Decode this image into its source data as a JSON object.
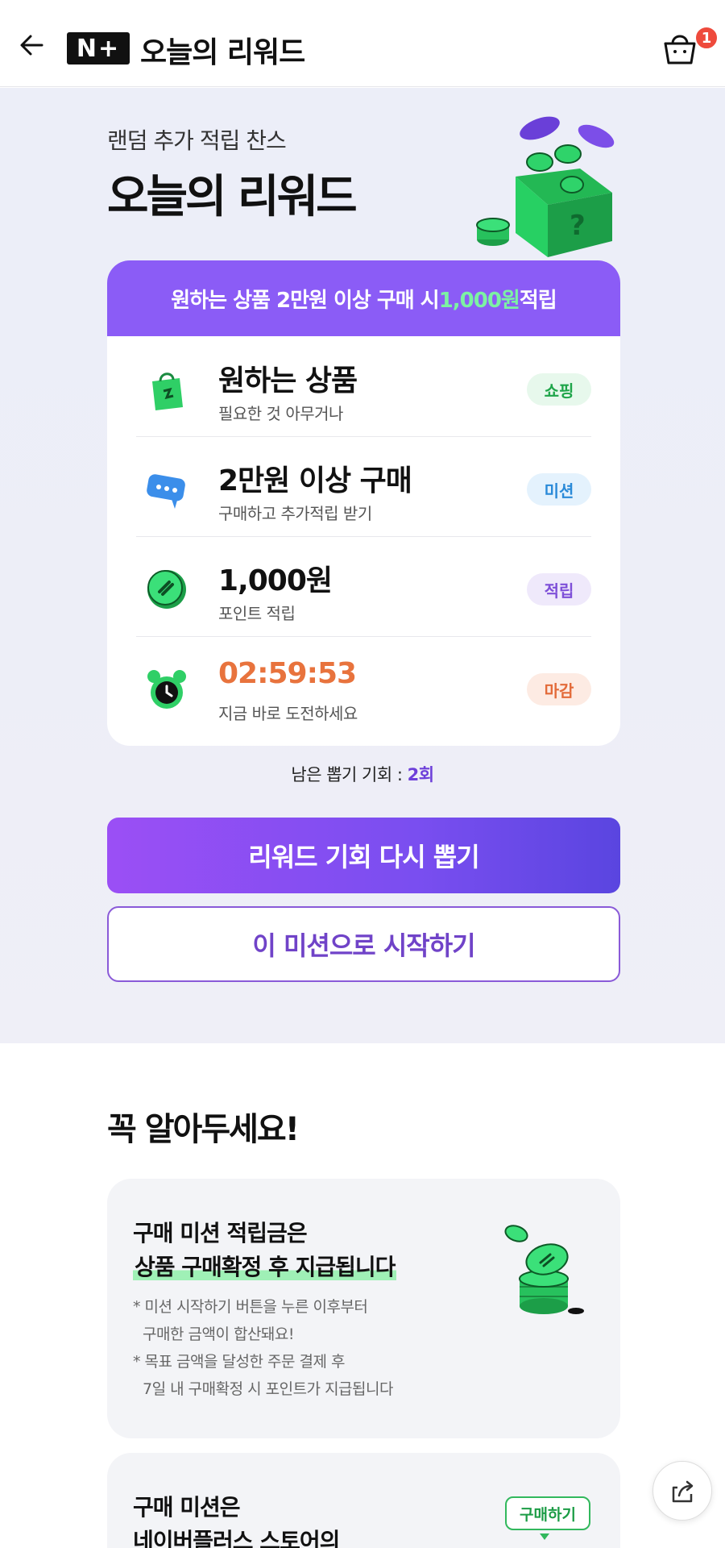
{
  "header": {
    "logo_text": "N+",
    "title": "오늘의 리워드",
    "cart_count": "1"
  },
  "hero": {
    "subtitle": "랜덤 추가 적립 찬스",
    "title": "오늘의 리워드"
  },
  "card": {
    "banner_prefix": "원하는 상품 2만원 이상 구매 시 ",
    "banner_highlight": "1,000원",
    "banner_suffix": " 적립",
    "rows": [
      {
        "main": "원하는 상품",
        "sub": "필요한 것 아무거나",
        "tag": "쇼핑",
        "icon": "shopping-bag-icon"
      },
      {
        "main": "2만원 이상 구매",
        "sub": "구매하고 추가적립 받기",
        "tag": "미션",
        "icon": "chat-bubble-icon"
      },
      {
        "main": "1,000원",
        "sub": "포인트 적립",
        "tag": "적립",
        "icon": "coin-icon"
      },
      {
        "main": "02:59:53",
        "sub": "지금 바로 도전하세요",
        "tag": "마감",
        "icon": "alarm-clock-icon"
      }
    ]
  },
  "remaining": {
    "label": "남은 뽑기 기회 : ",
    "count": "2회"
  },
  "buttons": {
    "redraw": "리워드 기회 다시 뽑기",
    "start": "이 미션으로 시작하기"
  },
  "notice": {
    "title": "꼭 알아두세요!",
    "card1": {
      "line1": "구매 미션 적립금은",
      "line2": "상품 구매확정 후 지급됩니다",
      "notes": [
        "* 미션 시작하기 버튼을 누른 이후부터",
        "  구매한 금액이 합산돼요!",
        "* 목표 금액을 달성한 주문 결제 후",
        "  7일 내 구매확정 시 포인트가 지급됩니다"
      ]
    },
    "card2": {
      "line1": "구매 미션은",
      "line2": "네이버플러스 스토어의",
      "tag": "구매하기"
    }
  },
  "colors": {
    "accent_purple": "#8b5cf6",
    "highlight_green": "#7cf2a3",
    "timer_orange": "#e8733d",
    "badge_red": "#ee4a3c"
  }
}
